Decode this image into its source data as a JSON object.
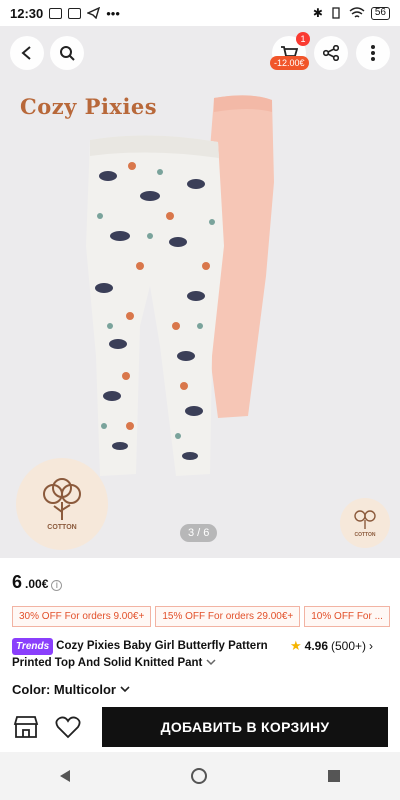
{
  "status": {
    "time": "12:30",
    "battery": "56",
    "more": "•••"
  },
  "header": {
    "back_icon": "chevron-left-icon",
    "search_icon": "search-icon",
    "cart_badge": "1",
    "cart_discount": "-12.00€",
    "share_icon": "share-icon",
    "menu_icon": "more-vert-icon"
  },
  "hero": {
    "brand": "Cozy Pixies",
    "pager": "3 / 6",
    "cotton_label": "COTTON",
    "colors": {
      "background": "#ecebed",
      "pink": "#f6c6b6",
      "print_base": "#f2f1ee"
    }
  },
  "price": {
    "main": "6",
    "currency": ".00€",
    "info_icon": "i"
  },
  "coupons": [
    "30% OFF For orders 9.00€+",
    "15% OFF For orders 29.00€+",
    "10% OFF For ..."
  ],
  "coupon_more": "›",
  "product": {
    "badge": "Trends",
    "title": "Cozy Pixies Baby Girl Butterfly Pattern Printed Top And Solid Knitted Pant",
    "rating": "4.96",
    "reviews": "(500+)",
    "rating_arrow": "›"
  },
  "color": {
    "label": "Color: Multicolor"
  },
  "actions": {
    "add_to_cart": "ДОБАВИТЬ В КОРЗИНУ"
  },
  "theme": {
    "accent": "#e2502a",
    "badge_red": "#fa3a31",
    "trends_purple": "#8a3ffc",
    "button_black": "#111111"
  }
}
